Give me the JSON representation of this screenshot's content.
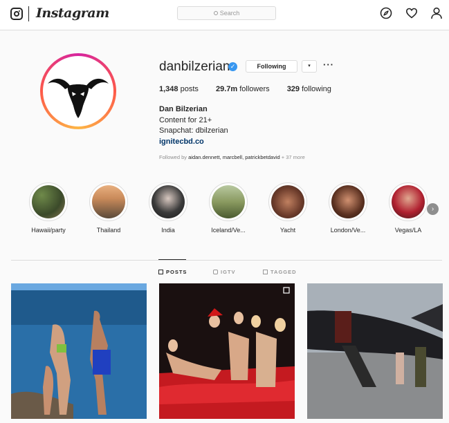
{
  "header": {
    "app_name": "Instagram",
    "search_placeholder": "Search"
  },
  "profile": {
    "username": "danbilzerian",
    "verified": true,
    "follow_button_label": "Following",
    "dropdown_label": "▾",
    "more_label": "···",
    "stats": {
      "posts_count": "1,348",
      "posts_label": "posts",
      "followers_count": "29.7m",
      "followers_label": "followers",
      "following_count": "329",
      "following_label": "following"
    },
    "bio": {
      "full_name": "Dan Bilzerian",
      "line1": "Content for 21+",
      "line2": "Snapchat: dbilzerian",
      "link": "ignitecbd.co"
    },
    "followed_by": {
      "prefix": "Followed by ",
      "names": "aidan.dennett, marcbell, patrickbetdavid",
      "suffix": " + 37 more"
    }
  },
  "highlights": [
    {
      "label": "Hawaii/party"
    },
    {
      "label": "Thailand"
    },
    {
      "label": "India"
    },
    {
      "label": "Iceland/Ve..."
    },
    {
      "label": "Yacht"
    },
    {
      "label": "London/Ve..."
    },
    {
      "label": "Vegas/LA"
    }
  ],
  "tabs": [
    {
      "label": "POSTS",
      "active": true
    },
    {
      "label": "IGTV",
      "active": false
    },
    {
      "label": "TAGGED",
      "active": false
    }
  ],
  "colors": {
    "accent_blue": "#3897f0",
    "link_blue": "#003569",
    "border": "#dbdbdb",
    "muted": "#8e8e8e"
  }
}
